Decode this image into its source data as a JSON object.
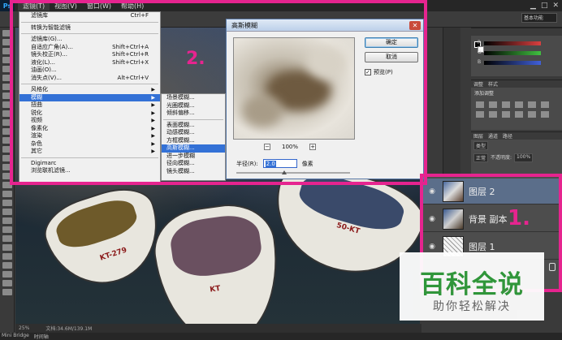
{
  "menubar": {
    "logo": "Ps",
    "items": [
      "滤镜(T)",
      "视图(V)",
      "窗口(W)",
      "帮助(H)"
    ]
  },
  "workspace": {
    "label": "基本功能"
  },
  "filter_menu": {
    "items": [
      {
        "label": "滤镜库",
        "shortcut": "Ctrl+F"
      },
      {
        "label": "转换为智能滤镜",
        "shortcut": ""
      },
      {
        "label": "滤镜库(G)...",
        "shortcut": ""
      },
      {
        "label": "自适应广角(A)...",
        "shortcut": "Shift+Ctrl+A"
      },
      {
        "label": "镜头校正(R)...",
        "shortcut": "Shift+Ctrl+R"
      },
      {
        "label": "液化(L)...",
        "shortcut": "Shift+Ctrl+X"
      },
      {
        "label": "油画(O)...",
        "shortcut": ""
      },
      {
        "label": "消失点(V)...",
        "shortcut": "Alt+Ctrl+V"
      },
      {
        "label": "风格化",
        "shortcut": ""
      },
      {
        "label": "模糊",
        "shortcut": ""
      },
      {
        "label": "扭曲",
        "shortcut": ""
      },
      {
        "label": "锐化",
        "shortcut": ""
      },
      {
        "label": "视频",
        "shortcut": ""
      },
      {
        "label": "像素化",
        "shortcut": ""
      },
      {
        "label": "渲染",
        "shortcut": ""
      },
      {
        "label": "杂色",
        "shortcut": ""
      },
      {
        "label": "其它",
        "shortcut": ""
      },
      {
        "label": "Digimarc",
        "shortcut": ""
      },
      {
        "label": "浏览联机滤镜...",
        "shortcut": ""
      }
    ]
  },
  "blur_menu": {
    "items": [
      "场景模糊...",
      "光圈模糊...",
      "倾斜偏移...",
      "表面模糊...",
      "动感模糊...",
      "方框模糊...",
      "高斯模糊...",
      "进一步模糊",
      "径向模糊...",
      "镜头模糊..."
    ]
  },
  "dialog": {
    "title": "高斯模糊",
    "ok_label": "确定",
    "cancel_label": "取消",
    "preview_label": "预览(P)",
    "preview_checked": true,
    "zoom": "100%",
    "zoom_minus": "−",
    "zoom_plus": "+",
    "radius_label": "半径(R):",
    "radius_value": "2.0",
    "radius_unit": "像素"
  },
  "canvas": {
    "boat_labels": [
      "KT-279",
      "50-KT",
      "KT"
    ]
  },
  "status": {
    "zoom": "25%",
    "doc": "文档:34.6M/139.1M"
  },
  "bottom_tabs": [
    "Mini Bridge",
    "时间轴"
  ],
  "panels": {
    "adjust_tabs": [
      "调整",
      "样式"
    ],
    "adjust_title": "添加调整",
    "layer_tabs": [
      "图层",
      "通道",
      "路径"
    ],
    "kind_label": "类型",
    "blend_label": "正常",
    "opacity_label": "不透明度:",
    "opacity_value": "100%"
  },
  "color_panel": {
    "slider_labels": [
      "R",
      "G",
      "B"
    ],
    "slider_colors": [
      "#d94040",
      "#40c040",
      "#4060d9"
    ]
  },
  "layers": [
    {
      "name": "图层 2"
    },
    {
      "name": "背景 副本"
    },
    {
      "name": "图层 1"
    }
  ],
  "annotations": {
    "label_1": "1.",
    "label_2": "2."
  },
  "watermark": {
    "title": "百科全说",
    "subtitle": "助你轻松解决"
  },
  "colors": {
    "accent": "#e6248f",
    "menu_highlight": "#3371d6"
  }
}
